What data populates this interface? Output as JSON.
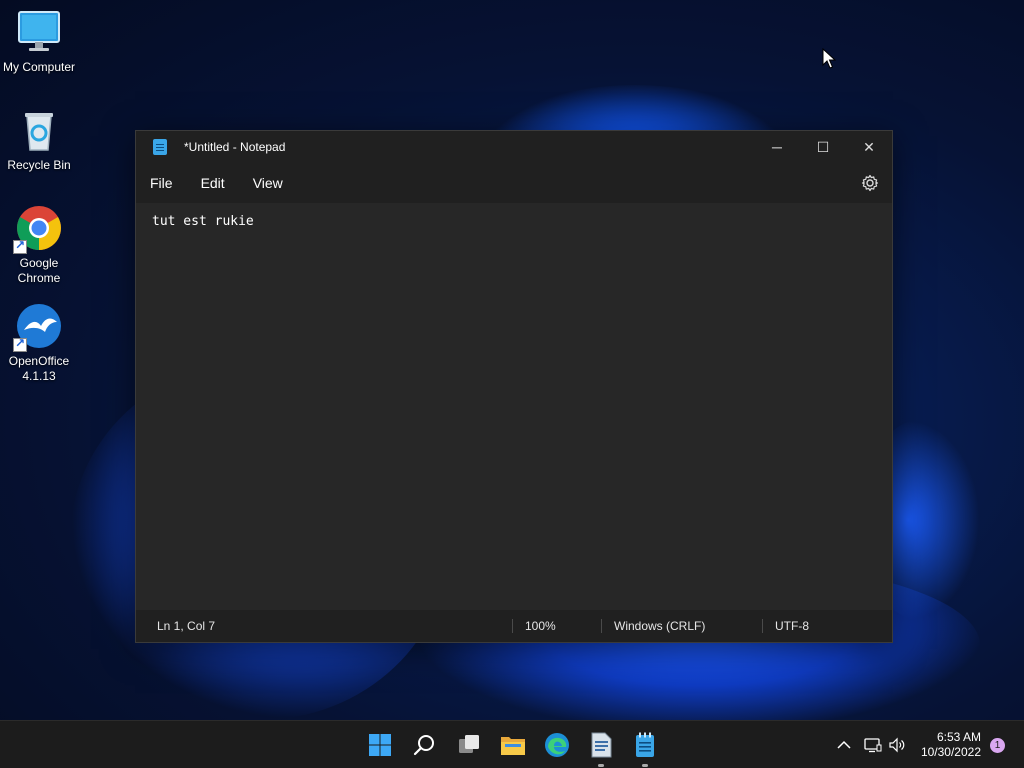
{
  "desktop": {
    "icons": [
      {
        "label": "My Computer"
      },
      {
        "label": "Recycle Bin"
      },
      {
        "label": "Google Chrome"
      },
      {
        "label": "OpenOffice 4.1.13"
      }
    ]
  },
  "notepad": {
    "title": "*Untitled - Notepad",
    "menu": [
      "File",
      "Edit",
      "View"
    ],
    "content": "tut est rukie",
    "status": {
      "position": "Ln 1, Col 7",
      "zoom": "100%",
      "line_ending": "Windows (CRLF)",
      "encoding": "UTF-8"
    },
    "controls": {
      "minimize": "─",
      "maximize": "☐",
      "close": "✕"
    }
  },
  "taskbar": {
    "clock_time": "6:53 AM",
    "clock_date": "10/30/2022",
    "notification_count": "1",
    "tray_chevron": "^"
  },
  "colors": {
    "window_bg": "#272727",
    "titlebar_bg": "#202020",
    "taskbar_bg": "#1c1c1c",
    "accent_blue": "#1a6cff",
    "notification_badge": "#d9a7f0"
  }
}
